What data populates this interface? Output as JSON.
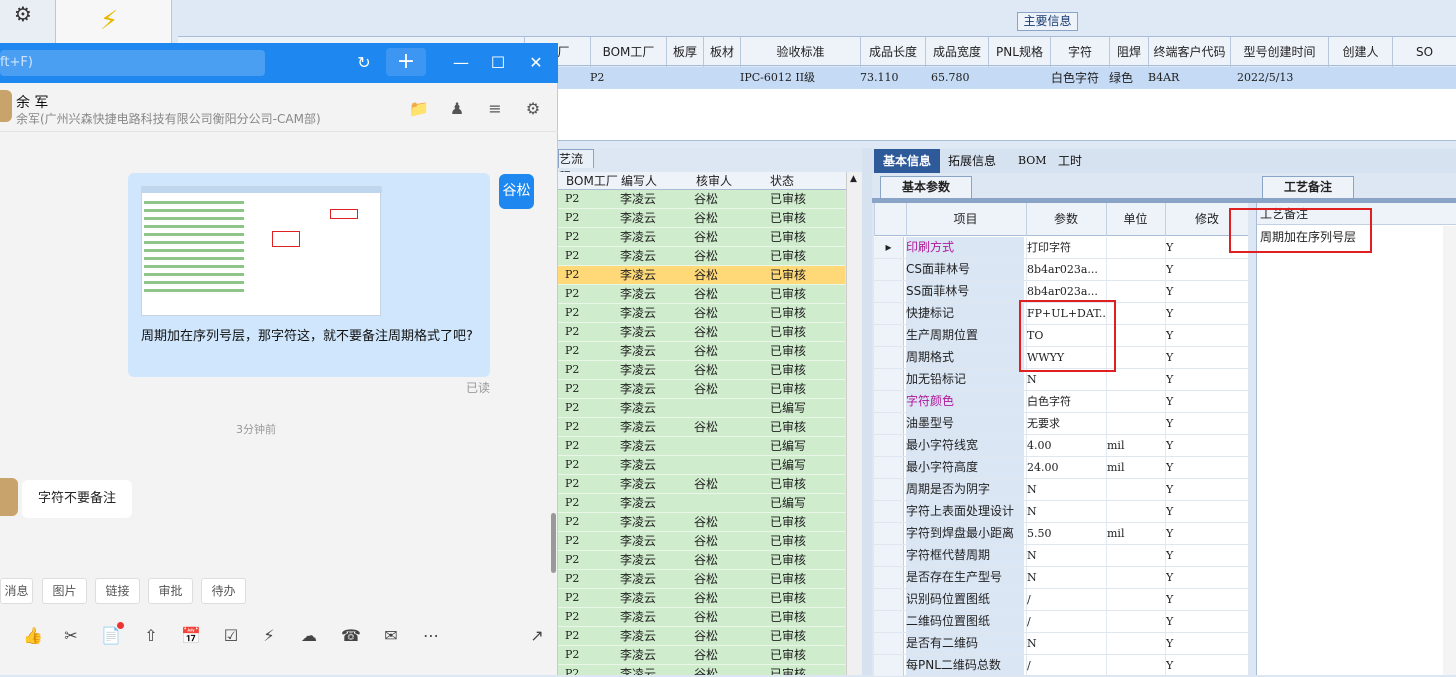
{
  "erp": {
    "main_info_label": "主要信息",
    "columns": [
      "工厂",
      "BOM工厂",
      "板厚",
      "板材",
      "验收标准",
      "成品长度",
      "成品宽度",
      "PNL规格",
      "字符",
      "阻焊",
      "终端客户代码",
      "型号创建时间",
      "创建人",
      "SO"
    ],
    "row": {
      "bom_factory": "P2",
      "standard": "IPC-6012 II级",
      "length": "73.110",
      "width": "65.780",
      "char": "白色字符",
      "mask": "绿色",
      "customer": "B4AR",
      "created": "2022/5/13"
    }
  },
  "chat": {
    "search_placeholder": "ft+F)",
    "contact_name": "余 军",
    "contact_sub": "余军(广州兴森快捷电路科技有限公司衡阳分公司-CAM部)",
    "my_avatar": "谷松",
    "my_message": "周期加在序列号层，那字符这，就不要备注周期格式了吧?",
    "read_status": "已读",
    "time_label": "3分钟前",
    "reply": "字符不要备注",
    "quick_tags": [
      "消息",
      "图片",
      "链接",
      "审批",
      "待办"
    ]
  },
  "process": {
    "tab_label": "艺流程",
    "headers": [
      "BOM工厂",
      "编写人",
      "核审人",
      "状态"
    ],
    "rows": [
      [
        "P2",
        "李凌云",
        "谷松",
        "已审核"
      ],
      [
        "P2",
        "李凌云",
        "谷松",
        "已审核"
      ],
      [
        "P2",
        "李凌云",
        "谷松",
        "已审核"
      ],
      [
        "P2",
        "李凌云",
        "谷松",
        "已审核"
      ],
      [
        "P2",
        "李凌云",
        "谷松",
        "已审核"
      ],
      [
        "P2",
        "李凌云",
        "谷松",
        "已审核"
      ],
      [
        "P2",
        "李凌云",
        "谷松",
        "已审核"
      ],
      [
        "P2",
        "李凌云",
        "谷松",
        "已审核"
      ],
      [
        "P2",
        "李凌云",
        "谷松",
        "已审核"
      ],
      [
        "P2",
        "李凌云",
        "谷松",
        "已审核"
      ],
      [
        "P2",
        "李凌云",
        "谷松",
        "已审核"
      ],
      [
        "P2",
        "李凌云",
        "",
        "已编写"
      ],
      [
        "P2",
        "李凌云",
        "谷松",
        "已审核"
      ],
      [
        "P2",
        "李凌云",
        "",
        "已编写"
      ],
      [
        "P2",
        "李凌云",
        "",
        "已编写"
      ],
      [
        "P2",
        "李凌云",
        "谷松",
        "已审核"
      ],
      [
        "P2",
        "李凌云",
        "",
        "已编写"
      ],
      [
        "P2",
        "李凌云",
        "谷松",
        "已审核"
      ],
      [
        "P2",
        "李凌云",
        "谷松",
        "已审核"
      ],
      [
        "P2",
        "李凌云",
        "谷松",
        "已审核"
      ],
      [
        "P2",
        "李凌云",
        "谷松",
        "已审核"
      ],
      [
        "P2",
        "李凌云",
        "谷松",
        "已审核"
      ],
      [
        "P2",
        "李凌云",
        "谷松",
        "已审核"
      ],
      [
        "P2",
        "李凌云",
        "谷松",
        "已审核"
      ],
      [
        "P2",
        "李凌云",
        "谷松",
        "已审核"
      ],
      [
        "P2",
        "李凌云",
        "谷松",
        "已审核"
      ]
    ]
  },
  "detail": {
    "tabs": [
      "基本信息",
      "拓展信息",
      "BOM",
      "工时"
    ],
    "sub_tab": "基本参数",
    "headers": [
      "项目",
      "参数",
      "单位",
      "修改"
    ],
    "rows": [
      {
        "item": "印刷方式",
        "param": "打印字符",
        "unit": "",
        "mod": "Y",
        "hl": true
      },
      {
        "item": "CS面菲林号",
        "param": "8b4ar023a...",
        "unit": "",
        "mod": "Y"
      },
      {
        "item": "SS面菲林号",
        "param": "8b4ar023a...",
        "unit": "",
        "mod": "Y"
      },
      {
        "item": "快捷标记",
        "param": "FP+UL+DAT...",
        "unit": "",
        "mod": "Y"
      },
      {
        "item": "生产周期位置",
        "param": "TO",
        "unit": "",
        "mod": "Y"
      },
      {
        "item": "周期格式",
        "param": "WWYY",
        "unit": "",
        "mod": "Y"
      },
      {
        "item": "加无铅标记",
        "param": "N",
        "unit": "",
        "mod": "Y"
      },
      {
        "item": "字符颜色",
        "param": "白色字符",
        "unit": "",
        "mod": "Y",
        "hl": true
      },
      {
        "item": "油墨型号",
        "param": "无要求",
        "unit": "",
        "mod": "Y"
      },
      {
        "item": "最小字符线宽",
        "param": "4.00",
        "unit": "mil",
        "mod": "Y"
      },
      {
        "item": "最小字符高度",
        "param": "24.00",
        "unit": "mil",
        "mod": "Y"
      },
      {
        "item": "周期是否为阴字",
        "param": "N",
        "unit": "",
        "mod": "Y"
      },
      {
        "item": "字符上表面处理设计",
        "param": "N",
        "unit": "",
        "mod": "Y"
      },
      {
        "item": "字符到焊盘最小距离",
        "param": "5.50",
        "unit": "mil",
        "mod": "Y"
      },
      {
        "item": "字符框代替周期",
        "param": "N",
        "unit": "",
        "mod": "Y"
      },
      {
        "item": "是否存在生产型号",
        "param": "N",
        "unit": "",
        "mod": "Y"
      },
      {
        "item": "识别码位置图纸",
        "param": "/",
        "unit": "",
        "mod": "Y"
      },
      {
        "item": "二维码位置图纸",
        "param": "/",
        "unit": "",
        "mod": "Y"
      },
      {
        "item": "是否有二维码",
        "param": "N",
        "unit": "",
        "mod": "Y"
      },
      {
        "item": "每PNL二维码总数",
        "param": "/",
        "unit": "",
        "mod": "Y"
      }
    ],
    "craft_tab": "工艺备注",
    "craft_header": "工艺备注",
    "craft_value": "周期加在序列号层"
  }
}
